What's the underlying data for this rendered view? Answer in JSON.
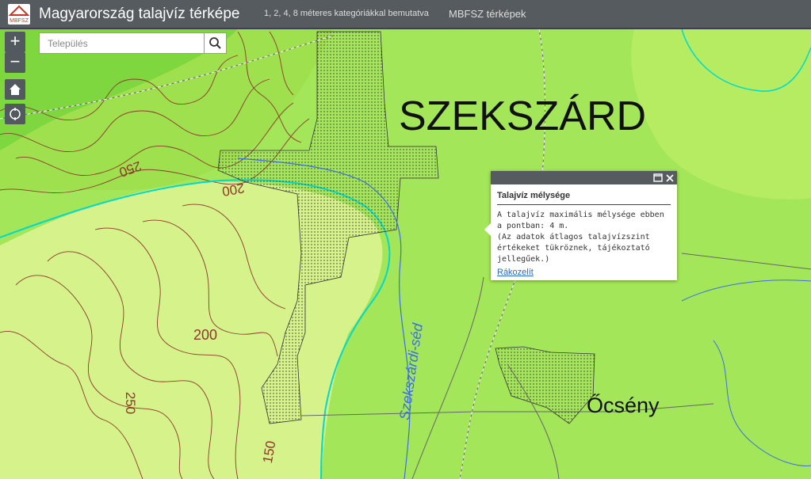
{
  "header": {
    "title": "Magyarország talajvíz térképe",
    "subtitle": "1, 2, 4, 8 méteres kategóriákkal bemutatva",
    "link": "MBFSZ térképek",
    "logo_text": "MBFSZ"
  },
  "search": {
    "placeholder": "Település"
  },
  "controls": {
    "zoom_in": "+",
    "zoom_out": "−"
  },
  "popup": {
    "title": "Talajvíz mélysége",
    "text": "A talajvíz maximális mélysége ebben a pontban: 4 m.\n(Az adatok átlagos talajvízszint értékeket tükröznek, tájékoztató jellegűek.)",
    "link": "Rákozelít"
  },
  "map": {
    "city_label": "SZEKSZÁRD",
    "village_label": "Őcsény",
    "stream_label": "Szekszárdi-séd",
    "contours": [
      "250",
      "200",
      "200",
      "250",
      "150"
    ]
  },
  "colors": {
    "zone_light": "#d6f28a",
    "zone_mid": "#a3e65a",
    "zone_dark": "#7fd73f",
    "contour": "#8b3a2a",
    "water": "#00d8c8",
    "stream": "#3c6fe0",
    "header": "#565b5f"
  }
}
